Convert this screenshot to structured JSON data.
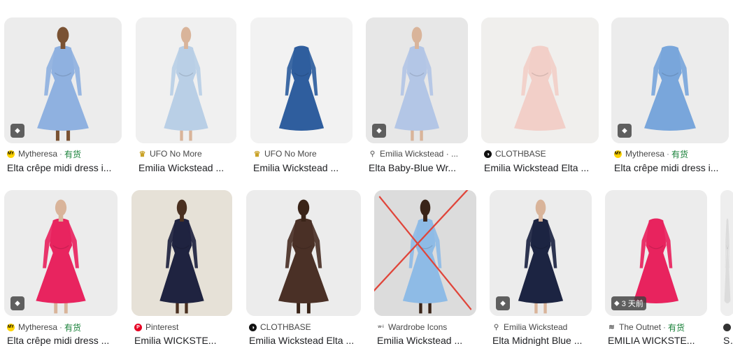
{
  "row1": [
    {
      "source": "Mytheresa",
      "stock": "有货",
      "title": "Elta crêpe midi dress i...",
      "favicon": "mytheresa-icon",
      "dress": "#8fb1e0",
      "bg": "#ececec",
      "skin": "#7a5233",
      "tag": true
    },
    {
      "source": "UFO No More",
      "title": "Emilia Wickstead ...",
      "favicon": "crown-icon",
      "dress": "#b9cfe6",
      "bg": "#f0f0f0",
      "skin": "#d9b49a",
      "tag": false
    },
    {
      "source": "UFO No More",
      "title": "Emilia Wickstead ...",
      "favicon": "crown-icon",
      "dress": "#2f5e9e",
      "bg": "#f2f2f2",
      "skin": "",
      "tag": false
    },
    {
      "source": "Emilia Wickstead · ...",
      "title": "Elta Baby-Blue Wr...",
      "favicon": "hanger-icon",
      "dress": "#b3c6e6",
      "bg": "#e7e7e7",
      "skin": "#d9b49a",
      "tag": true
    },
    {
      "source": "CLOTHBASE",
      "title": "Emilia Wickstead Elta ...",
      "favicon": "clothbase-icon",
      "dress": "#f2cfc8",
      "bg": "#f0efed",
      "skin": "",
      "tag": false
    },
    {
      "source": "Mytheresa",
      "stock": "有货",
      "title": "Elta crêpe midi dress i...",
      "favicon": "mytheresa-icon",
      "dress": "#79a6db",
      "bg": "#ececec",
      "skin": "",
      "tag": true
    }
  ],
  "row2": [
    {
      "source": "Mytheresa",
      "stock": "有货",
      "title": "Elta crêpe midi dress ...",
      "favicon": "mytheresa-icon",
      "dress": "#e8245f",
      "bg": "#ececec",
      "skin": "#d9b49a",
      "tag": true,
      "tag_text": ""
    },
    {
      "source": "Pinterest",
      "title": "Emilia WICKSTE...",
      "favicon": "pinterest-icon",
      "dress": "#1f2340",
      "bg": "#e6e1d7",
      "skin": "#4a3020",
      "tag": false,
      "tag_text": ""
    },
    {
      "source": "CLOTHBASE",
      "title": "Emilia Wickstead Elta ...",
      "favicon": "clothbase-icon",
      "dress": "#4a3026",
      "bg": "#ececec",
      "skin": "#3a2418",
      "tag": false,
      "tag_text": ""
    },
    {
      "source": "Wardrobe Icons",
      "title": "Emilia Wickstead ...",
      "favicon": "wardrobe-icon",
      "dress": "#8ebbe6",
      "bg": "#dcdcdc",
      "skin": "#3a2418",
      "tag": false,
      "tag_text": "",
      "crossed": true
    },
    {
      "source": "Emilia Wickstead",
      "title": "Elta Midnight Blue ...",
      "favicon": "hanger-icon",
      "dress": "#1c2442",
      "bg": "#ececec",
      "skin": "#d9b49a",
      "tag": true,
      "tag_text": ""
    },
    {
      "source": "The Outnet",
      "stock": "有货",
      "title": "EMILIA WICKSTE...",
      "favicon": "outnet-icon",
      "dress": "#e8235e",
      "bg": "#ececec",
      "skin": "",
      "tag": true,
      "tag_text": "3 天前"
    },
    {
      "source": "",
      "title": "Sh...",
      "favicon": "generic-icon",
      "dress": "#dcdcdc",
      "bg": "#eeeeee",
      "skin": "",
      "tag": false,
      "tag_text": ""
    }
  ],
  "colors": {
    "stock": "#188038",
    "annotation": "#e0453a"
  }
}
